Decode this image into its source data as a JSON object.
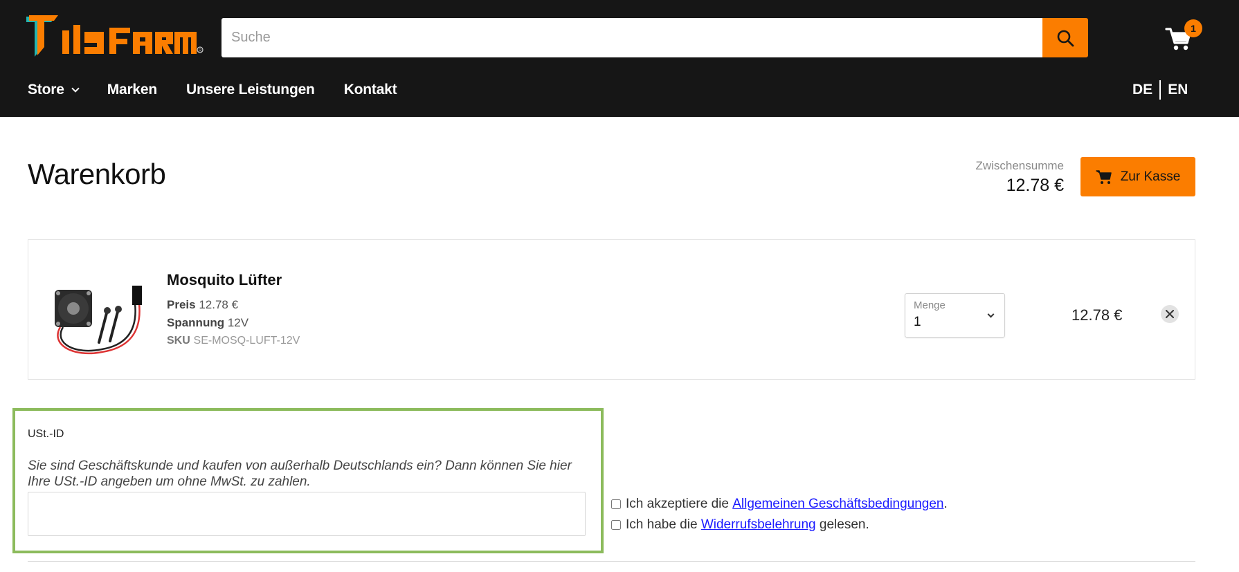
{
  "header": {
    "search_placeholder": "Suche",
    "cart_count": "1",
    "nav": [
      "Store",
      "Marken",
      "Unsere Leistungen",
      "Kontakt"
    ],
    "lang": [
      "DE",
      "EN"
    ]
  },
  "page": {
    "title": "Warenkorb",
    "subtotal_label": "Zwischensumme",
    "subtotal_value": "12.78 €",
    "checkout_label": "Zur Kasse"
  },
  "item": {
    "name": "Mosquito Lüfter",
    "price_label": "Preis",
    "price_value": "12.78 €",
    "voltage_label": "Spannung",
    "voltage_value": "12V",
    "sku_label": "SKU",
    "sku_value": "SE-MOSQ-LUFT-12V",
    "qty_label": "Menge",
    "qty_value": "1",
    "line_total": "12.78 €"
  },
  "vat": {
    "label": "USt.-ID",
    "description": "Sie sind Geschäftskunde und kaufen von außerhalb Deutschlands ein? Dann können Sie hier Ihre USt.-ID angeben um ohne MwSt. zu zahlen."
  },
  "terms": {
    "agb_prefix": "Ich akzeptiere die",
    "agb_link": "Allgemeinen Geschäftsbedingungen",
    "agb_suffix": ".",
    "revoke_prefix": "Ich habe die",
    "revoke_link": "Widerrufsbelehrung",
    "revoke_suffix": "gelesen."
  },
  "colors": {
    "accent": "#fb7d00",
    "header_bg": "#161616",
    "highlight_border": "#8cbb5c",
    "logo_teal": "#23b5b0"
  },
  "icons": {
    "search": "search-icon",
    "cart": "cart-icon",
    "remove": "close-icon",
    "chevron": "chevron-down-icon"
  }
}
